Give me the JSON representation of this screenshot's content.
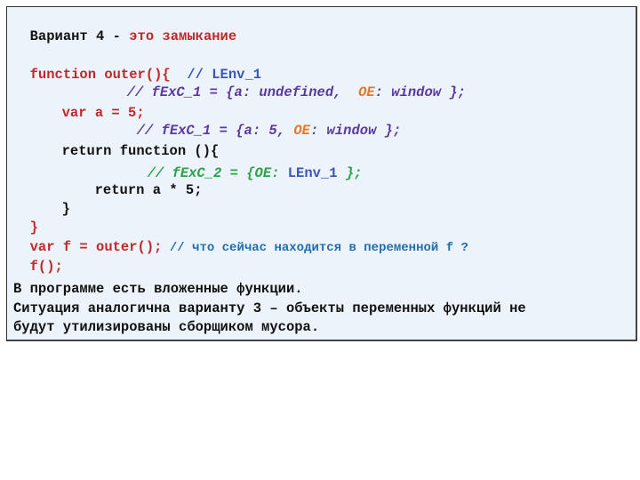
{
  "title": {
    "prefix": "Вариант 4 - ",
    "highlight": "это замыкание"
  },
  "code": {
    "line1": {
      "code": "function outer(){ ",
      "comment": " // LEnv_1"
    },
    "line2": {
      "c1": "// fExC_1 = {a: undefined,  ",
      "oe": "OE",
      "c2": ": window };"
    },
    "line3": {
      "code": "var a = 5;"
    },
    "line4": {
      "c1": "// fExC_1 = {a: 5, ",
      "oe": "OE",
      "c2": ": window };"
    },
    "line5": {
      "code": "return function (){"
    },
    "line6": {
      "c1": "// fExC_2 = {OE: ",
      "lenv": "LEnv_1",
      "c2": " };"
    },
    "line7": {
      "code": "return a * 5;"
    },
    "line8": {
      "code": "}"
    },
    "line9": {
      "code": "}"
    },
    "line10": {
      "code": "var f = outer();",
      "comment": " // что сейчас находится в переменной f ?"
    },
    "line11": {
      "code": "f();"
    }
  },
  "explanation": {
    "line1": "В программе есть вложенные функции.",
    "line2": "Ситуация аналогична варианту 3 – объекты переменных функций не",
    "line3": "будут утилизированы сборщиком мусора."
  }
}
